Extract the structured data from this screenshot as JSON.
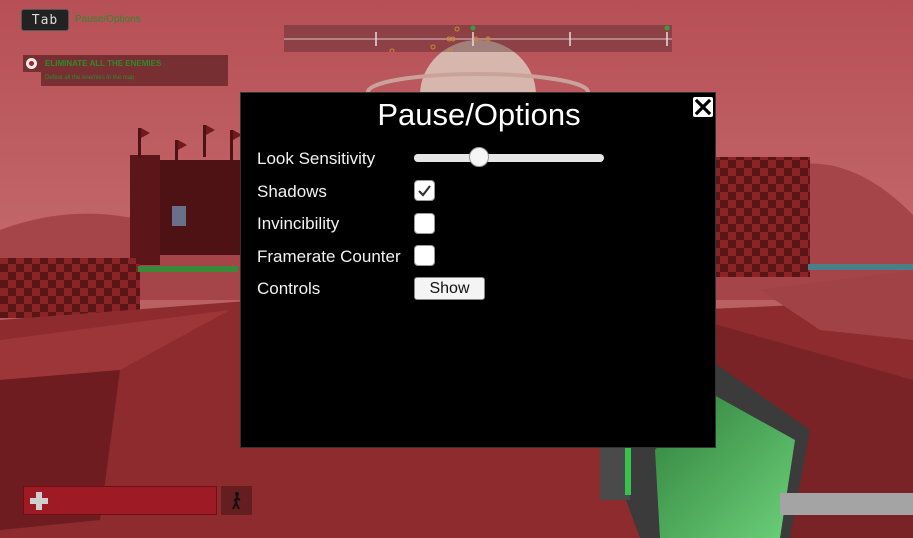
{
  "hud": {
    "tab_key": "Tab",
    "tab_hint": "Pause/Options",
    "objective": {
      "title": "ELIMINATE ALL THE ENEMIES",
      "description": "Defeat all the enemies in the map"
    }
  },
  "dialog": {
    "title": "Pause/Options",
    "close_icon": "close-icon",
    "options": {
      "look_sensitivity": {
        "label": "Look Sensitivity",
        "value": 0.34
      },
      "shadows": {
        "label": "Shadows",
        "checked": true
      },
      "invincibility": {
        "label": "Invincibility",
        "checked": false
      },
      "framerate_counter": {
        "label": "Framerate Counter",
        "checked": false
      },
      "controls": {
        "label": "Controls",
        "button_label": "Show"
      }
    }
  },
  "colors": {
    "health": "#9e1a24",
    "objective_text": "#2c8a2c",
    "panel": "#000000"
  }
}
